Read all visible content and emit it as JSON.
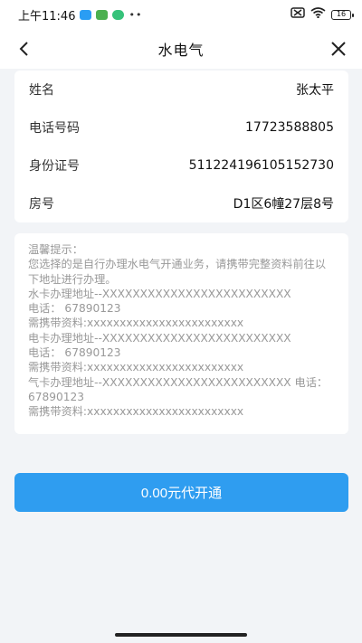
{
  "status_bar": {
    "time": "上午11:46",
    "dots": "••",
    "battery": "16",
    "colors": {
      "app1": "#2a9df4",
      "app2": "#4cb050",
      "app3": "#36c27a"
    }
  },
  "header": {
    "title": "水电气",
    "back_icon": "chevron-left-icon",
    "close_icon": "close-icon"
  },
  "info": {
    "rows": [
      {
        "label": "姓名",
        "value": "张太平"
      },
      {
        "label": "电话号码",
        "value": "17723588805"
      },
      {
        "label": "身份证号",
        "value": "511224196105152730"
      },
      {
        "label": "房号",
        "value": "D1区6幢27层8号"
      }
    ]
  },
  "tips": {
    "lines": [
      "温馨提示：",
      "您选择的是自行办理水电气开通业务，请携带完整资料前往以下地址进行办理。",
      "水卡办理地址--XXXXXXXXXXXXXXXXXXXXXXXXX",
      "电话：  67890123",
      "需携带资料:xxxxxxxxxxxxxxxxxxxxxxxx",
      "电卡办理地址--XXXXXXXXXXXXXXXXXXXXXXXXX",
      "电话：  67890123",
      "需携带资料:xxxxxxxxxxxxxxxxxxxxxxxx",
      "气卡办理地址--XXXXXXXXXXXXXXXXXXXXXXXXX 电话：  67890123",
      "需携带资料:xxxxxxxxxxxxxxxxxxxxxxxx"
    ]
  },
  "action": {
    "label": "0.00元代开通",
    "color": "#2f9df0"
  }
}
